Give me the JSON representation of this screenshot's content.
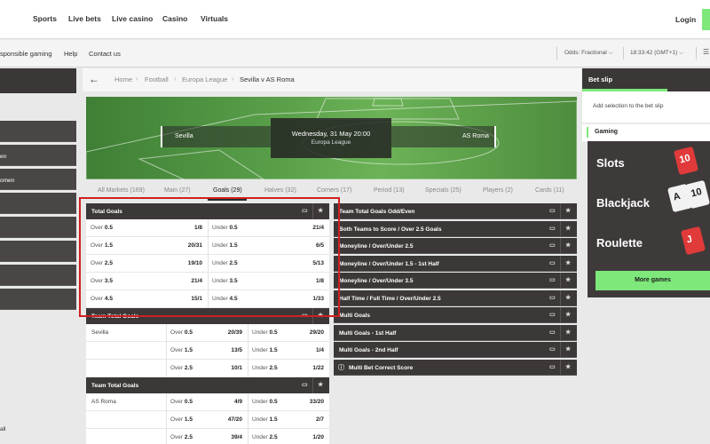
{
  "topnav": {
    "items": [
      "Sports",
      "Live bets",
      "Live casino",
      "Casino",
      "Virtuals"
    ],
    "login": "Login"
  },
  "subbar": {
    "links": [
      "sponsible gaming",
      "Help",
      "Contact us"
    ],
    "odds": "Odds:  Fractional",
    "time": "18:33:42  (GMT+1)"
  },
  "sidebar": {
    "items": [
      "",
      "en",
      "omen",
      "",
      "",
      "",
      "",
      ""
    ],
    "footer": "all"
  },
  "breadcrumb": [
    "Home",
    "Football",
    "Europa League",
    "Sevilla v AS Roma"
  ],
  "match": {
    "home": "Sevilla",
    "away": "AS Roma",
    "date": "Wednesday, 31 May 20:00",
    "competition": "Europa League"
  },
  "tabs": [
    {
      "label": "All Markets (169)",
      "active": false
    },
    {
      "label": "Main (27)",
      "active": false
    },
    {
      "label": "Goals (29)",
      "active": true
    },
    {
      "label": "Halves (32)",
      "active": false
    },
    {
      "label": "Corners (17)",
      "active": false
    },
    {
      "label": "Period (13)",
      "active": false
    },
    {
      "label": "Specials (25)",
      "active": false
    },
    {
      "label": "Players (2)",
      "active": false
    },
    {
      "label": "Cards (11)",
      "active": false
    }
  ],
  "total_goals": {
    "title": "Total Goals",
    "rows": [
      {
        "over_line": "0.5",
        "over_odd": "1/8",
        "under_line": "0.5",
        "under_odd": "21/4"
      },
      {
        "over_line": "1.5",
        "over_odd": "20/31",
        "under_line": "1.5",
        "under_odd": "6/5"
      },
      {
        "over_line": "2.5",
        "over_odd": "19/10",
        "under_line": "2.5",
        "under_odd": "5/13"
      },
      {
        "over_line": "3.5",
        "over_odd": "21/4",
        "under_line": "3.5",
        "under_odd": "1/8"
      },
      {
        "over_line": "4.5",
        "over_odd": "15/1",
        "under_line": "4.5",
        "under_odd": "1/33"
      }
    ]
  },
  "team_total_goals_1": {
    "title": "Team Total Goals",
    "team": "Sevilla",
    "rows": [
      {
        "over_line": "0.5",
        "over_odd": "20/39",
        "under_line": "0.5",
        "under_odd": "29/20"
      },
      {
        "over_line": "1.5",
        "over_odd": "13/5",
        "under_line": "1.5",
        "under_odd": "1/4"
      },
      {
        "over_line": "2.5",
        "over_odd": "10/1",
        "under_line": "2.5",
        "under_odd": "1/22"
      }
    ]
  },
  "team_total_goals_2": {
    "title": "Team Total Goals",
    "team": "AS Roma",
    "rows": [
      {
        "over_line": "0.5",
        "over_odd": "4/9",
        "under_line": "0.5",
        "under_odd": "33/20"
      },
      {
        "over_line": "1.5",
        "over_odd": "47/20",
        "under_line": "1.5",
        "under_odd": "2/7"
      },
      {
        "over_line": "2.5",
        "over_odd": "39/4",
        "under_line": "2.5",
        "under_odd": "1/20"
      }
    ]
  },
  "labels": {
    "over": "Over",
    "under": "Under"
  },
  "right_markets": [
    "Team Total Goals Odd/Even",
    "Both Teams to Score / Over 2.5 Goals",
    "Moneyline / Over/Under 2.5",
    "Moneyline / Over/Under 1.5 - 1st Half",
    "Moneyline / Over/Under 3.5",
    "Half Time / Full Time / Over/Under 2.5",
    "Multi Goals",
    "Multi Goals - 1st Half",
    "Multi Goals - 2nd Half",
    "Multi Bet Correct Score"
  ],
  "betslip": {
    "title": "Bet slip",
    "empty": "Add selection to the bet slip"
  },
  "gaming": {
    "title": "Gaming",
    "items": [
      "Slots",
      "Blackjack",
      "Roulette"
    ],
    "button": "More games",
    "card_glyphs": [
      "10",
      "A",
      "10",
      "J"
    ]
  },
  "icons": {
    "back": "arrow-left-icon",
    "breadcrumb_sep": "chevron-right-icon",
    "stats": "stats-icon",
    "favorite": "star-icon",
    "info": "info-icon"
  },
  "colors": {
    "accent": "#7ee87a",
    "dark": "#3d3838",
    "highlight": "#d01f1f"
  }
}
